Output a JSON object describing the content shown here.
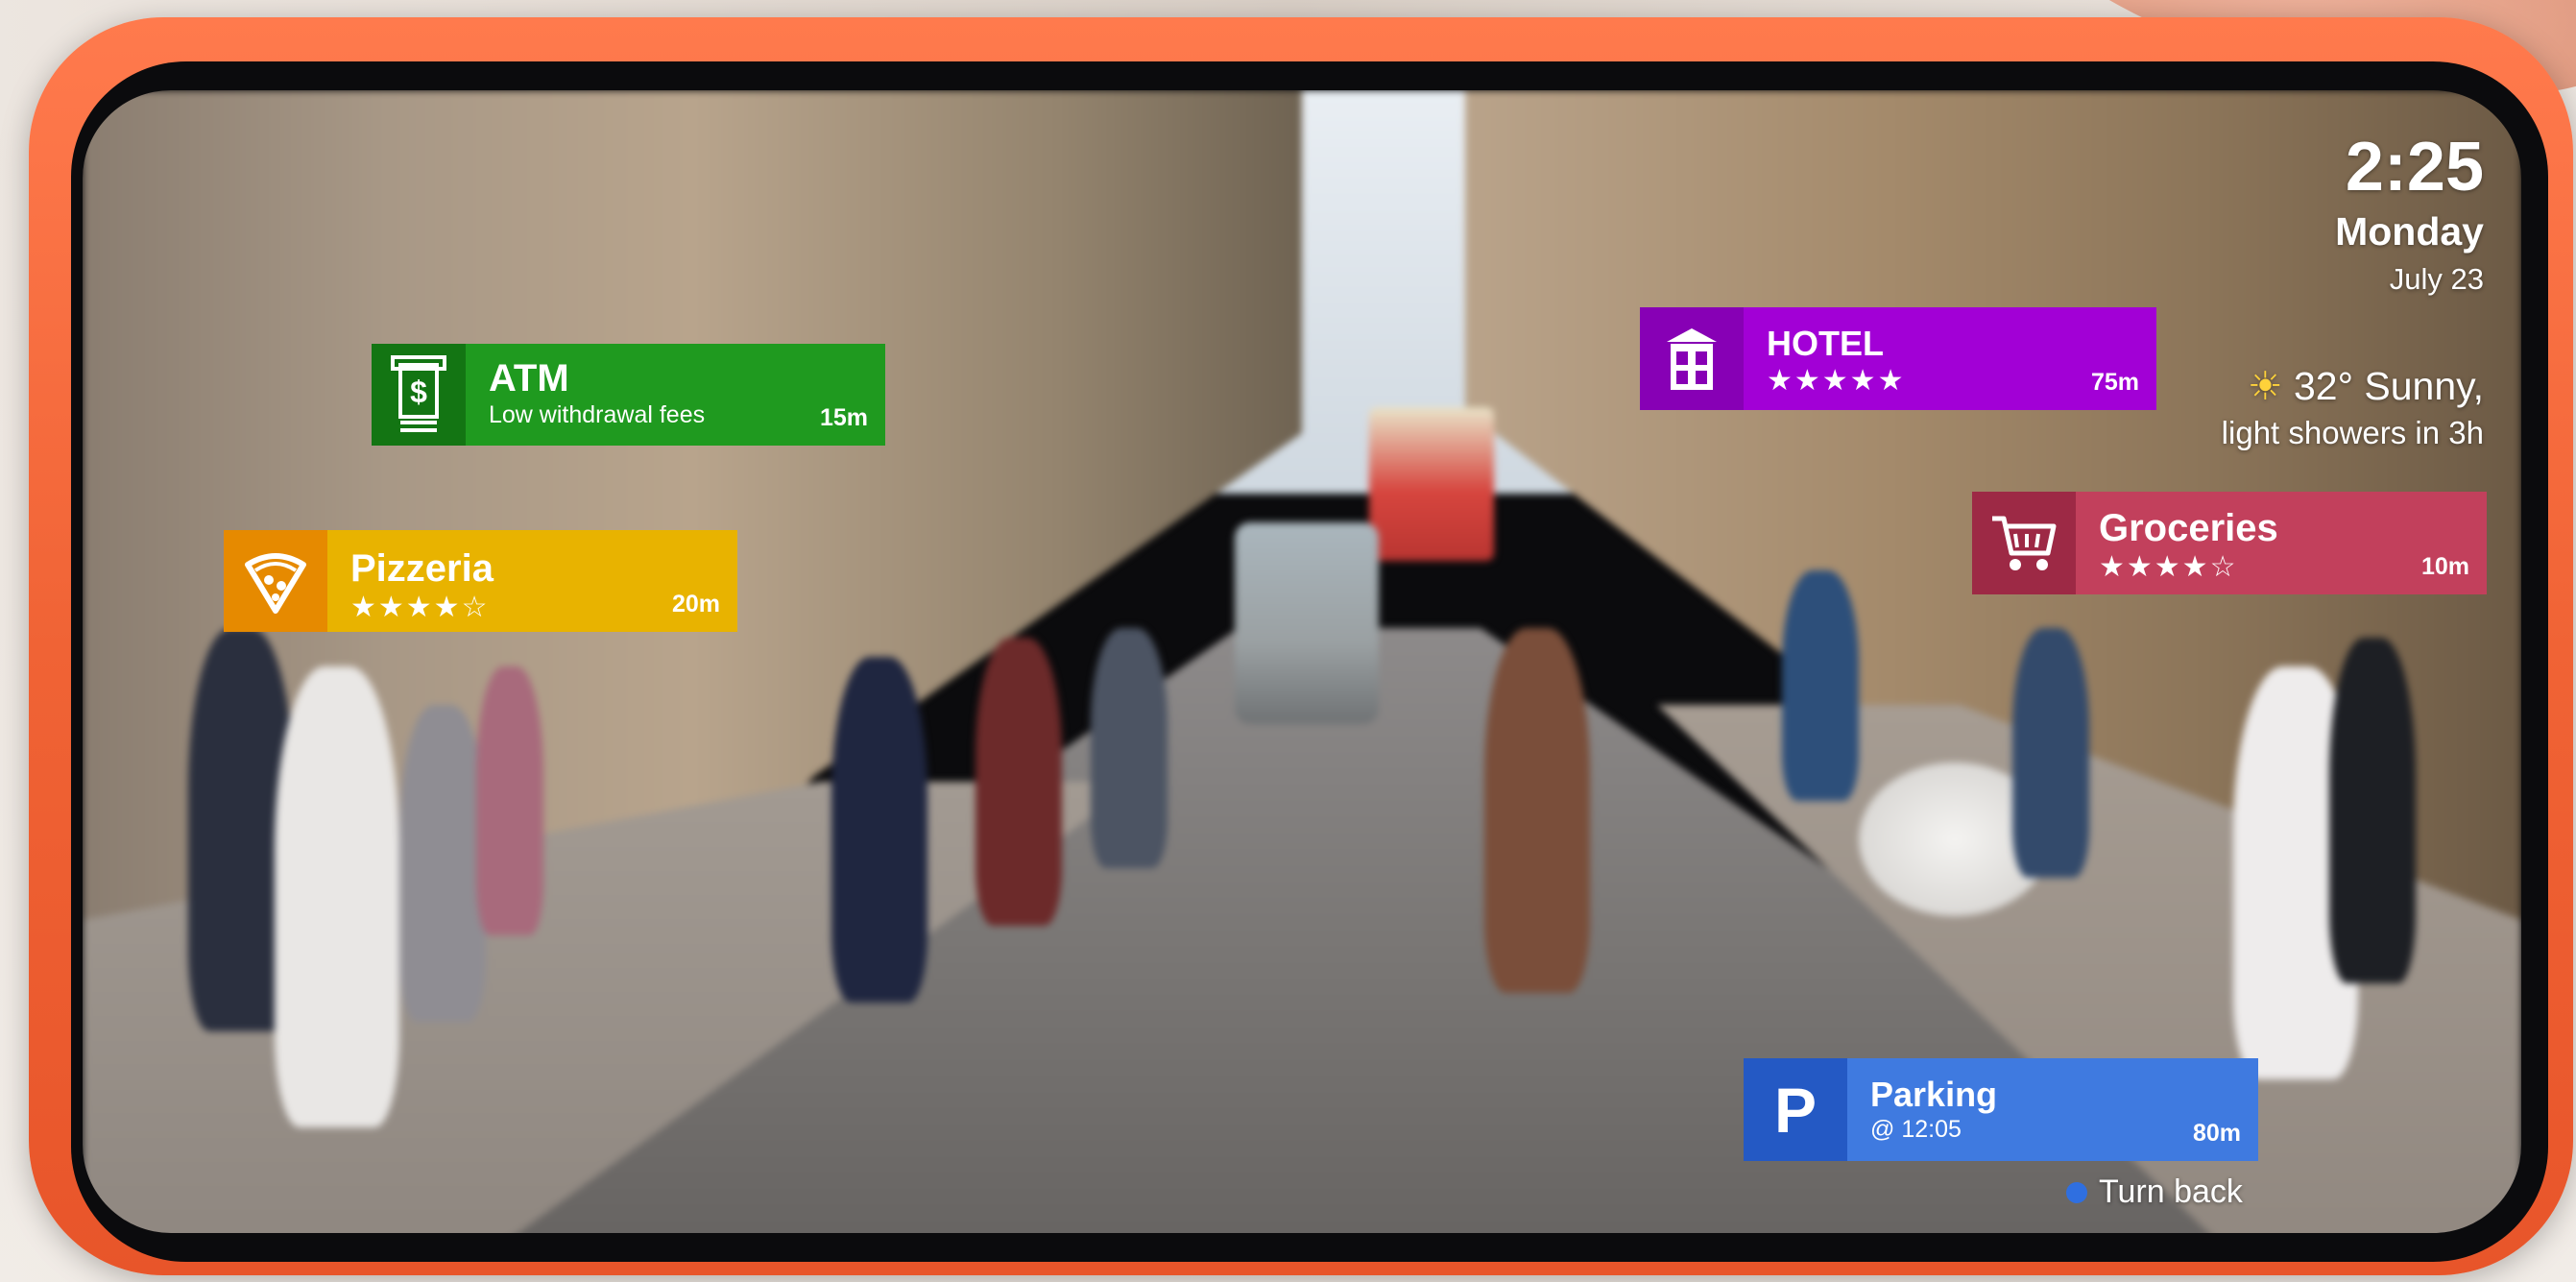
{
  "status": {
    "time": "2:25",
    "day": "Monday",
    "date": "July 23"
  },
  "weather": {
    "icon": "sun-icon",
    "line1": "32° Sunny,",
    "line2": "light showers in 3h"
  },
  "places": {
    "atm": {
      "title": "ATM",
      "subtitle": "Low withdrawal fees",
      "distance": "15m",
      "icon": "atm-icon",
      "color": "#1f9a1f",
      "icon_bg": "#137513"
    },
    "pizzeria": {
      "title": "Pizzeria",
      "stars": "★★★★☆",
      "rating": 4,
      "distance": "20m",
      "icon": "pizza-icon",
      "color": "#e8b300",
      "icon_bg": "#e68a00"
    },
    "hotel": {
      "title": "HOTEL",
      "stars": "★★★★★",
      "rating": 5,
      "distance": "75m",
      "icon": "building-icon",
      "color": "#a200d6",
      "icon_bg": "#8700b5"
    },
    "groceries": {
      "title": "Groceries",
      "stars": "★★★★☆",
      "rating": 4,
      "distance": "10m",
      "icon": "cart-icon",
      "color": "#c2405c",
      "icon_bg": "#9d2945"
    },
    "parking": {
      "title": "Parking",
      "subtitle": "@ 12:05",
      "distance": "80m",
      "icon": "parking-icon",
      "icon_letter": "P",
      "color": "#3f7ae0",
      "icon_bg": "#2459c4"
    }
  },
  "turnback": {
    "label": "Turn back"
  }
}
